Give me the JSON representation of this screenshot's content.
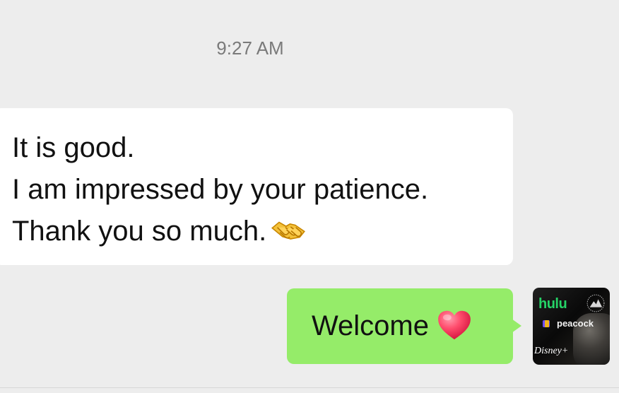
{
  "chat": {
    "timestamp": "9:27 AM",
    "incoming_message": {
      "lines": [
        "It is good.",
        "I am impressed by your patience.",
        "Thank you so much."
      ],
      "emoji_icon": "handshake-icon"
    },
    "outgoing_message": {
      "text": "Welcome",
      "emoji_icon": "heart-icon"
    },
    "avatar": {
      "brands": {
        "hulu": "hulu",
        "peacock": "peacock",
        "disney": "Disney+"
      }
    }
  },
  "colors": {
    "background": "#ededed",
    "incoming_bubble": "#ffffff",
    "outgoing_bubble": "#95ec69",
    "text": "#111111",
    "timestamp": "#7a7a7a",
    "hulu_green": "#25d366"
  }
}
